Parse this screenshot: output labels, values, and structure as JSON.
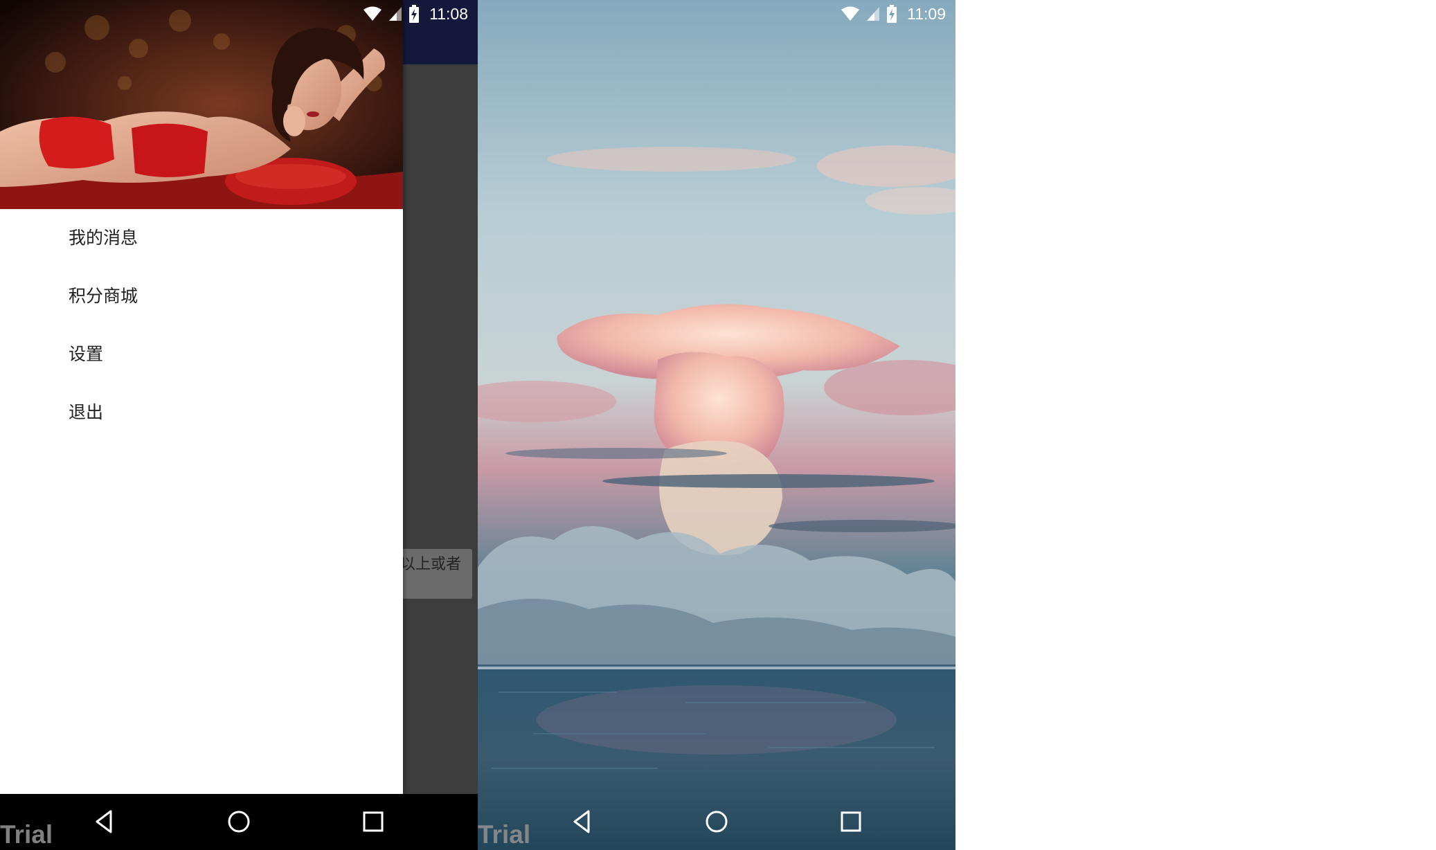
{
  "left_screen": {
    "status_bar": {
      "time": "11:08",
      "icons": [
        "wifi-icon",
        "cell-signal-icon",
        "battery-charging-icon"
      ]
    },
    "drawer": {
      "header_image": "portrait-photo",
      "menu_items": [
        {
          "label": "我的消息"
        },
        {
          "label": "积分商城"
        },
        {
          "label": "设置"
        },
        {
          "label": "退出"
        }
      ]
    },
    "content": {
      "chip_text": "以上或者"
    },
    "nav_bar": {
      "icons": [
        "back-icon",
        "home-icon",
        "recents-icon"
      ],
      "watermark": "Trial"
    }
  },
  "right_screen": {
    "status_bar": {
      "time": "11:09",
      "icons": [
        "wifi-icon",
        "cell-signal-icon",
        "battery-charging-icon"
      ]
    },
    "wallpaper": "cloud-over-sea-photo",
    "nav_bar": {
      "icons": [
        "back-icon",
        "home-icon",
        "recents-icon"
      ],
      "watermark": "Trial"
    }
  },
  "colors": {
    "toolbar": "#14183b",
    "scrim": "#3c3c3c",
    "drawer_bg": "#ffffff",
    "nav_bar": "#000000",
    "text": "#212121"
  }
}
